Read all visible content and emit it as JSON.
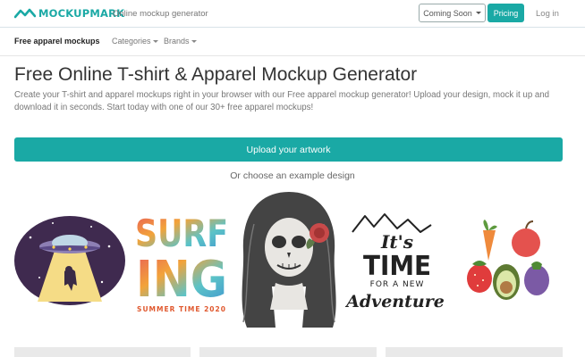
{
  "header": {
    "brand": "MOCKUPMARK",
    "tagline": "Online mockup generator",
    "coming_soon": "Coming Soon",
    "pricing": "Pricing",
    "login": "Log in",
    "accent": "#1aa9a5"
  },
  "subnav": {
    "active": "Free apparel mockups",
    "categories": "Categories",
    "brands": "Brands"
  },
  "main": {
    "title": "Free Online T-shirt & Apparel Mockup Generator",
    "description": "Create your T-shirt and apparel mockups right in your browser with our Free apparel mockup generator! Upload your design, mock it up and download it in seconds. Start today with one of our 30+ free apparel mockups!",
    "upload_label": "Upload your artwork",
    "choose_label": "Or choose an example design"
  },
  "examples": {
    "surfing_word1": "SURF",
    "surfing_word2": "ING",
    "surfing_caption": "SUMMER TIME 2020",
    "time_line1": "It's",
    "time_line2": "TIME",
    "time_line3": "FOR A NEW",
    "time_line4": "Adventure"
  }
}
